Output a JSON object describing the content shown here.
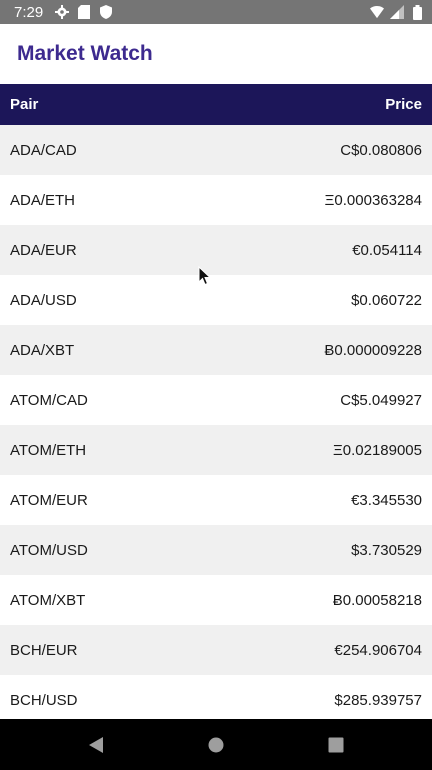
{
  "status": {
    "time": "7:29",
    "icons_left": [
      "settings-icon",
      "sd-card-icon",
      "shield-icon"
    ],
    "icons_right": [
      "wifi-icon",
      "signal-icon",
      "battery-icon"
    ]
  },
  "appbar": {
    "title": "Market Watch",
    "title_color": "#3d2a8f"
  },
  "table": {
    "header_bg": "#1c1659",
    "columns": {
      "pair": "Pair",
      "price": "Price"
    },
    "rows": [
      {
        "pair": "ADA/CAD",
        "price": "C$0.080806"
      },
      {
        "pair": "ADA/ETH",
        "price": "Ξ0.000363284"
      },
      {
        "pair": "ADA/EUR",
        "price": "€0.054114"
      },
      {
        "pair": "ADA/USD",
        "price": "$0.060722"
      },
      {
        "pair": "ADA/XBT",
        "price": "Ƀ0.000009228"
      },
      {
        "pair": "ATOM/CAD",
        "price": "C$5.049927"
      },
      {
        "pair": "ATOM/ETH",
        "price": "Ξ0.02189005"
      },
      {
        "pair": "ATOM/EUR",
        "price": "€3.345530"
      },
      {
        "pair": "ATOM/USD",
        "price": "$3.730529"
      },
      {
        "pair": "ATOM/XBT",
        "price": "Ƀ0.00058218"
      },
      {
        "pair": "BCH/EUR",
        "price": "€254.906704"
      },
      {
        "pair": "BCH/USD",
        "price": "$285.939757"
      }
    ]
  },
  "navbar": {
    "buttons": [
      "back-icon",
      "home-icon",
      "recents-icon"
    ]
  }
}
